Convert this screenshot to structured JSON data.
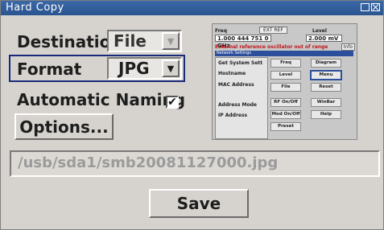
{
  "window": {
    "title": "Hard Copy"
  },
  "destination": {
    "label": "Destination",
    "value": "File"
  },
  "format": {
    "label": "Format",
    "value": "JPG"
  },
  "automatic_naming": {
    "label": "Automatic Naming",
    "checked": true,
    "check_glyph": "✔"
  },
  "options_button": {
    "label": "Options..."
  },
  "file_path": {
    "value": "/usb/sda1/smb20081127000.jpg"
  },
  "save_button": {
    "label": "Save"
  },
  "preview": {
    "freq_label": "Freq",
    "ext_ref": "EXT REF",
    "level_label": "Level",
    "freq_value": "1.000 444 751 0 GHz",
    "level_value": "2.000 mV",
    "warning": "External reference oscillator out of range",
    "info": "Info",
    "tabs": "Network Settings",
    "left_items": [
      "Get System Sett",
      "Hostname",
      "MAC Address",
      "Address Mode",
      "IP Address"
    ],
    "buttons": [
      "Freq",
      "Diagram",
      "Level",
      "Menu",
      "File",
      "Reset",
      "RF On/Off",
      "WinBar",
      "Mod On/Off",
      "Help",
      "Preset"
    ]
  },
  "colors": {
    "titlebar": "#3b68a6",
    "dialog_bg": "#d6d3ce",
    "format_highlight": "#1a2a7a",
    "warning_text": "#c0161b"
  }
}
